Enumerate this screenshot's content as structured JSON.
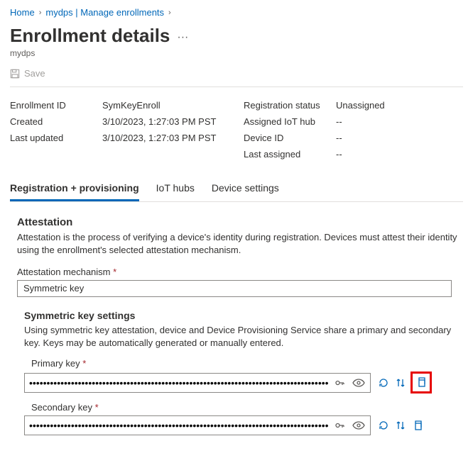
{
  "breadcrumb": {
    "home": "Home",
    "mid": "mydps | Manage enrollments"
  },
  "page": {
    "title": "Enrollment details",
    "subtitle": "mydps"
  },
  "toolbar": {
    "save_label": "Save"
  },
  "details_left": {
    "enrollment_id_label": "Enrollment ID",
    "enrollment_id_value": "SymKeyEnroll",
    "created_label": "Created",
    "created_value": "3/10/2023, 1:27:03 PM PST",
    "last_updated_label": "Last updated",
    "last_updated_value": "3/10/2023, 1:27:03 PM PST"
  },
  "details_right": {
    "registration_status_label": "Registration status",
    "registration_status_value": "Unassigned",
    "assigned_iot_hub_label": "Assigned IoT hub",
    "assigned_iot_hub_value": "--",
    "device_id_label": "Device ID",
    "device_id_value": "--",
    "last_assigned_label": "Last assigned",
    "last_assigned_value": "--"
  },
  "tabs": {
    "registration": "Registration + provisioning",
    "iot_hubs": "IoT hubs",
    "device_settings": "Device settings"
  },
  "attestation": {
    "heading": "Attestation",
    "desc": "Attestation is the process of verifying a device's identity during registration. Devices must attest their identity using the enrollment's selected attestation mechanism.",
    "mechanism_label": "Attestation mechanism",
    "mechanism_value": "Symmetric key"
  },
  "symkey": {
    "heading": "Symmetric key settings",
    "desc": "Using symmetric key attestation, device and Device Provisioning Service share a primary and secondary key. Keys may be automatically generated or manually entered.",
    "primary_label": "Primary key",
    "primary_value": "••••••••••••••••••••••••••••••••••••••••••••••••••••••••••••••••••••••••••••••••••••••••",
    "secondary_label": "Secondary key",
    "secondary_value": "••••••••••••••••••••••••••••••••••••••••••••••••••••••••••••••••••••••••••••••••••••••••"
  }
}
